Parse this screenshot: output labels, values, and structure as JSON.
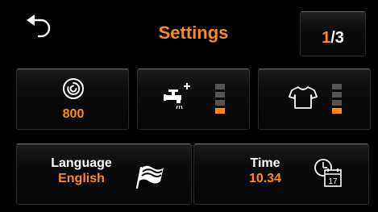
{
  "header": {
    "title": "Settings",
    "page_current": "1",
    "page_separator": "/",
    "page_total": "3"
  },
  "tiles": {
    "spin": {
      "value": "800",
      "icon": "spin-speed-icon",
      "highlight_level": "selected"
    },
    "rinse": {
      "icon": "water-plus-icon",
      "level_filled": 1,
      "level_total": 4
    },
    "dry": {
      "icon": "shirt-icon",
      "level_filled": 1,
      "level_total": 4
    },
    "language": {
      "label": "Language",
      "value": "English",
      "icon": "flag-icon"
    },
    "time": {
      "label": "Time",
      "value": "10.34",
      "icon": "clock-calendar-icon",
      "calendar_day": "17"
    }
  },
  "colors": {
    "accent": "#ff8a1e",
    "text": "#ffffff",
    "background": "#000000",
    "level_empty": "#555555",
    "level_filled": "#ff8a1e"
  },
  "icons": {
    "back": "back-arrow-icon"
  }
}
